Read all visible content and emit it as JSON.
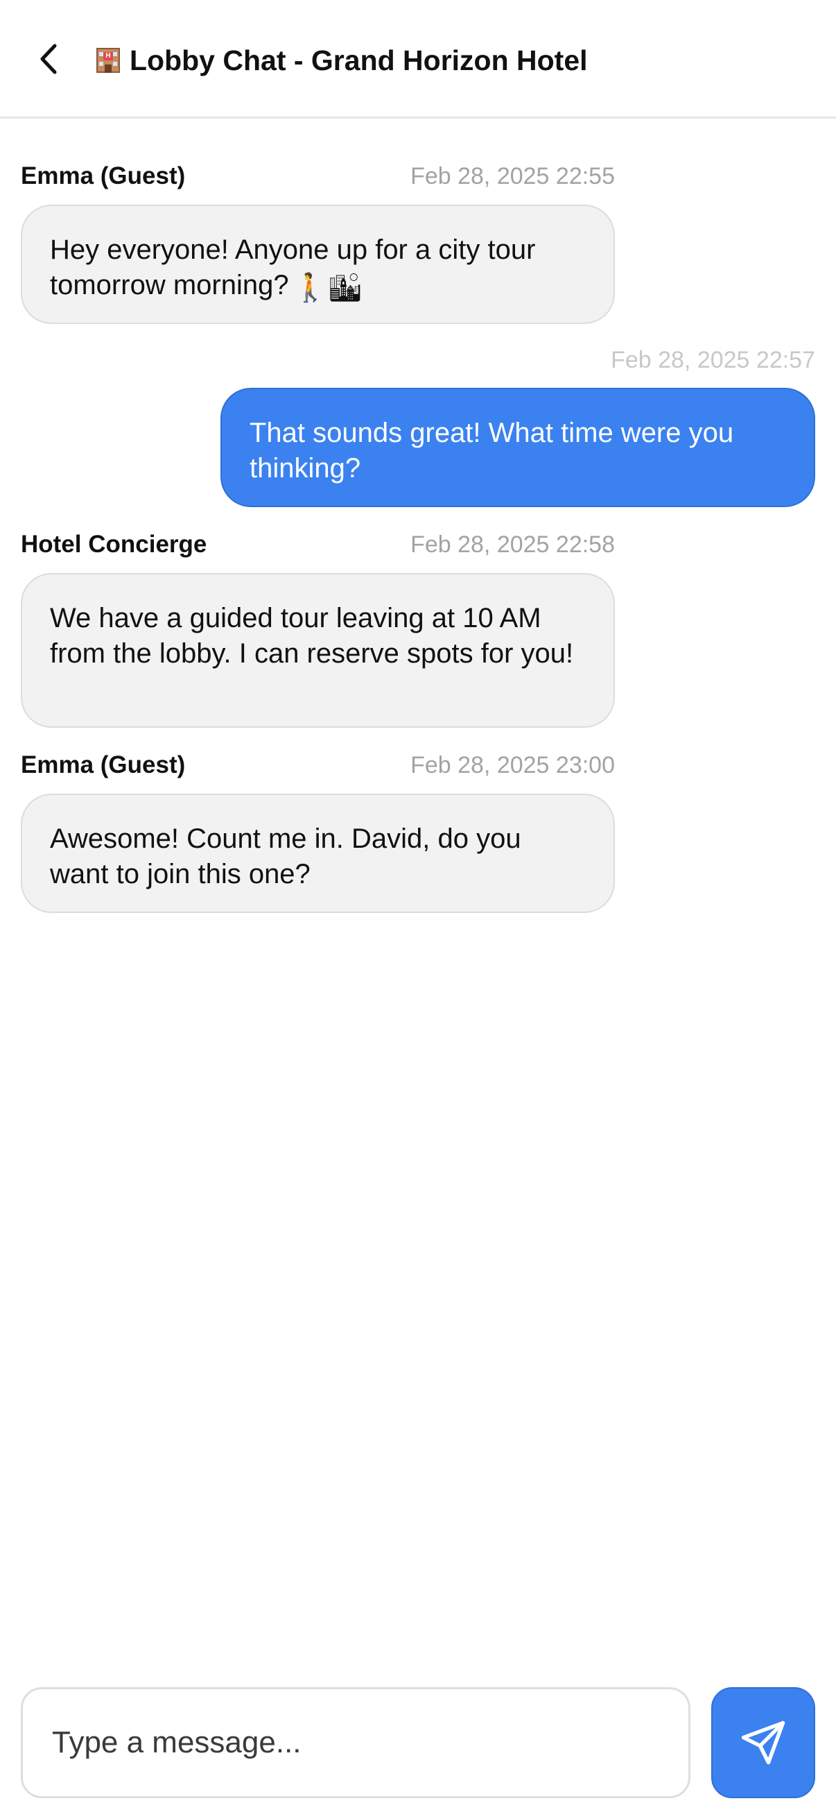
{
  "header": {
    "title": "Lobby Chat - Grand Horizon Hotel",
    "title_icon": "hotel-icon",
    "back_icon": "chevron-left-icon"
  },
  "messages": [
    {
      "sender": "Emma (Guest)",
      "timestamp": "Feb 28, 2025 22:55",
      "text": "Hey everyone! Anyone up for a city tour tomorrow morning?",
      "emojis": "🚶🏙",
      "mine": false
    },
    {
      "sender": "",
      "timestamp": "Feb 28, 2025 22:57",
      "text": "That sounds great! What time were you thinking?",
      "mine": true
    },
    {
      "sender": "Hotel Concierge",
      "timestamp": "Feb 28, 2025 22:58",
      "text": "We have a guided tour leaving at 10 AM from the lobby. I can reserve spots for you!",
      "mine": false
    },
    {
      "sender": "Emma (Guest)",
      "timestamp": "Feb 28, 2025 23:00",
      "text": "Awesome! Count me in. David, do you want to join this one?",
      "mine": false
    }
  ],
  "composer": {
    "placeholder": "Type a message...",
    "value": "",
    "send_icon": "send-icon"
  },
  "colors": {
    "accent": "#3b82f0",
    "bubble_other": "#f2f2f2",
    "timestamp": "#a3a3a3"
  }
}
